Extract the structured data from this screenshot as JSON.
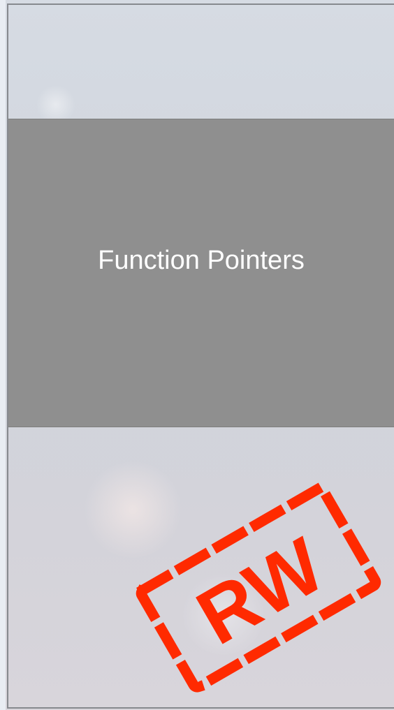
{
  "diagram": {
    "segment_label": "Function Pointers",
    "stamp_text": "RW",
    "colors": {
      "segment_fill": "#8f8f8f",
      "segment_text": "#ffffff",
      "border": "#86898e",
      "stamp": "#ff2a00"
    }
  }
}
